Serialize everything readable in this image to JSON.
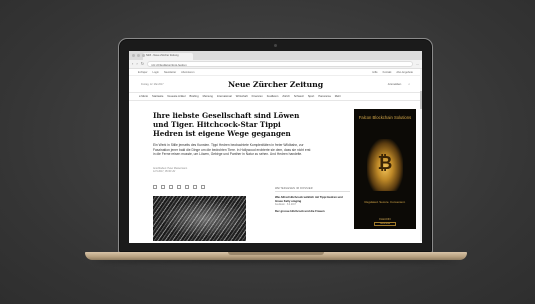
{
  "browser": {
    "tab_title": "NZZ - Neue Zürcher Zeitung",
    "url": "nzz.ch/feuilleton/tippi-hedren",
    "back": "‹",
    "forward": "›",
    "reload": "↻",
    "extensions": "⋯"
  },
  "topstrip": {
    "items": [
      "E-Paper",
      "Login",
      "Newsletter",
      "Abonnieren"
    ],
    "right_items": [
      "Hilfe",
      "Kontakt",
      "Abo-Angebote"
    ]
  },
  "masthead": {
    "date": "Freitag, 12. Mai 2017",
    "logo": "Neue Zürcher Zeitung",
    "account": "Anmelden",
    "search_icon": "search-icon"
  },
  "nav": {
    "items": [
      "≡ Menü",
      "Startseite",
      "Neueste Artikel",
      "Briefing",
      "Meinung",
      "International",
      "Wirtschaft",
      "Finanzen",
      "Feuilleton",
      "Zürich",
      "Schweiz",
      "Sport",
      "Panorama",
      "Mehr"
    ]
  },
  "article": {
    "headline": "Ihre liebste Gesellschaft sind Löwen und Tiger. Hitchcock-Star Tippi Hedren ist eigene Wege gegangen",
    "lead": "Ein Werk in Stille jenseits des Kunsten. Tippi Hedren beobachtete Komplexitäten in freier Wildbahn, zur Faszination jener bald die Dinge um die bedrohten Tiere. In Hollywood erobterte sie dem, dass sie nicht erst in die Ferne reisen musste, um Löwen, Gebirge und Panther in Natur zu sehen. Und Hedren handelte.",
    "byline_1": "Anschließen: Peter Mustermann",
    "byline_2": "12.5.2017, 05:30 Uhr"
  },
  "related": {
    "label": "WEITERLESEN IM DOSSIER",
    "title_1": "Wie Alfred Hitchcock wirklich mit Tippi Hedren und Grace Kelly umging",
    "meta_1": "Feuilleton · 8.4.2017",
    "title_2": "Der grosse Hitchcock und die Frauen"
  },
  "ad": {
    "title": "Falcon Blockchain Solutions",
    "tagline": "Regulated. Secure. Convenient.",
    "logo": "FALCON",
    "cta": "Learn more"
  },
  "colors": {
    "ad_gold": "#d6a94a",
    "laptop_gold": "#c8b08c",
    "background": "#3a3a3a"
  }
}
